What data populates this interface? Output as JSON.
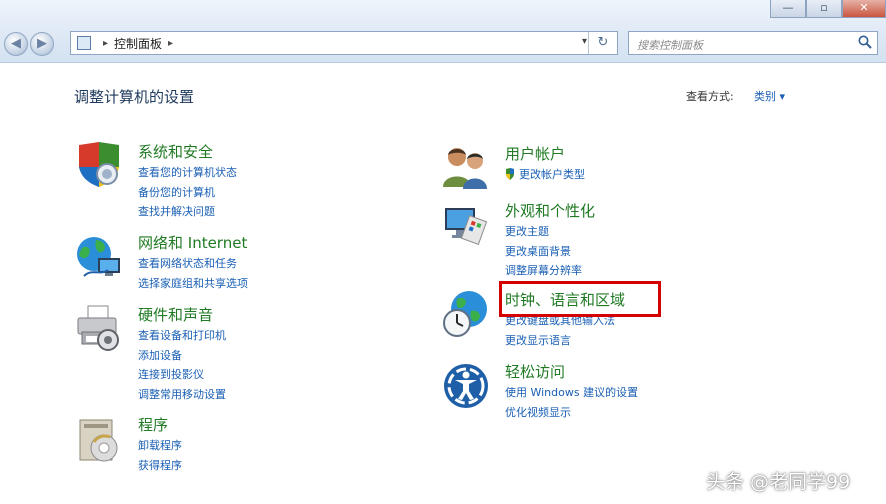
{
  "window": {
    "minimize": "—",
    "maximize": "▫",
    "close": "✕"
  },
  "nav": {
    "back": "◀",
    "forward": "▶"
  },
  "address": {
    "arrow": "▸",
    "path": "控制面板",
    "path_arrow": "▸",
    "dropdown": "▾",
    "refresh": "↻"
  },
  "search": {
    "placeholder": "搜索控制面板"
  },
  "header": {
    "title": "调整计算机的设置",
    "view_by_label": "查看方式:",
    "view_by_value": "类别 ▾"
  },
  "left_categories": [
    {
      "title": "系统和安全",
      "links": [
        "查看您的计算机状态",
        "备份您的计算机",
        "查找并解决问题"
      ]
    },
    {
      "title": "网络和 Internet",
      "links": [
        "查看网络状态和任务",
        "选择家庭组和共享选项"
      ]
    },
    {
      "title": "硬件和声音",
      "links": [
        "查看设备和打印机",
        "添加设备",
        "连接到投影仪",
        "调整常用移动设置"
      ]
    },
    {
      "title": "程序",
      "links": [
        "卸载程序",
        "获得程序"
      ]
    }
  ],
  "right_categories": [
    {
      "title": "用户帐户",
      "links": [
        "更改帐户类型"
      ]
    },
    {
      "title": "外观和个性化",
      "links": [
        "更改主题",
        "更改桌面背景",
        "调整屏幕分辨率"
      ]
    },
    {
      "title": "时钟、语言和区域",
      "links": [
        "更改键盘或其他输入法",
        "更改显示语言"
      ]
    },
    {
      "title": "轻松访问",
      "links": [
        "使用 Windows 建议的设置",
        "优化视频显示"
      ]
    }
  ],
  "watermark": "头条 @老同学99",
  "colors": {
    "category_title": "#1f7a23",
    "link": "#1a5fb4",
    "highlight": "#d40000"
  }
}
